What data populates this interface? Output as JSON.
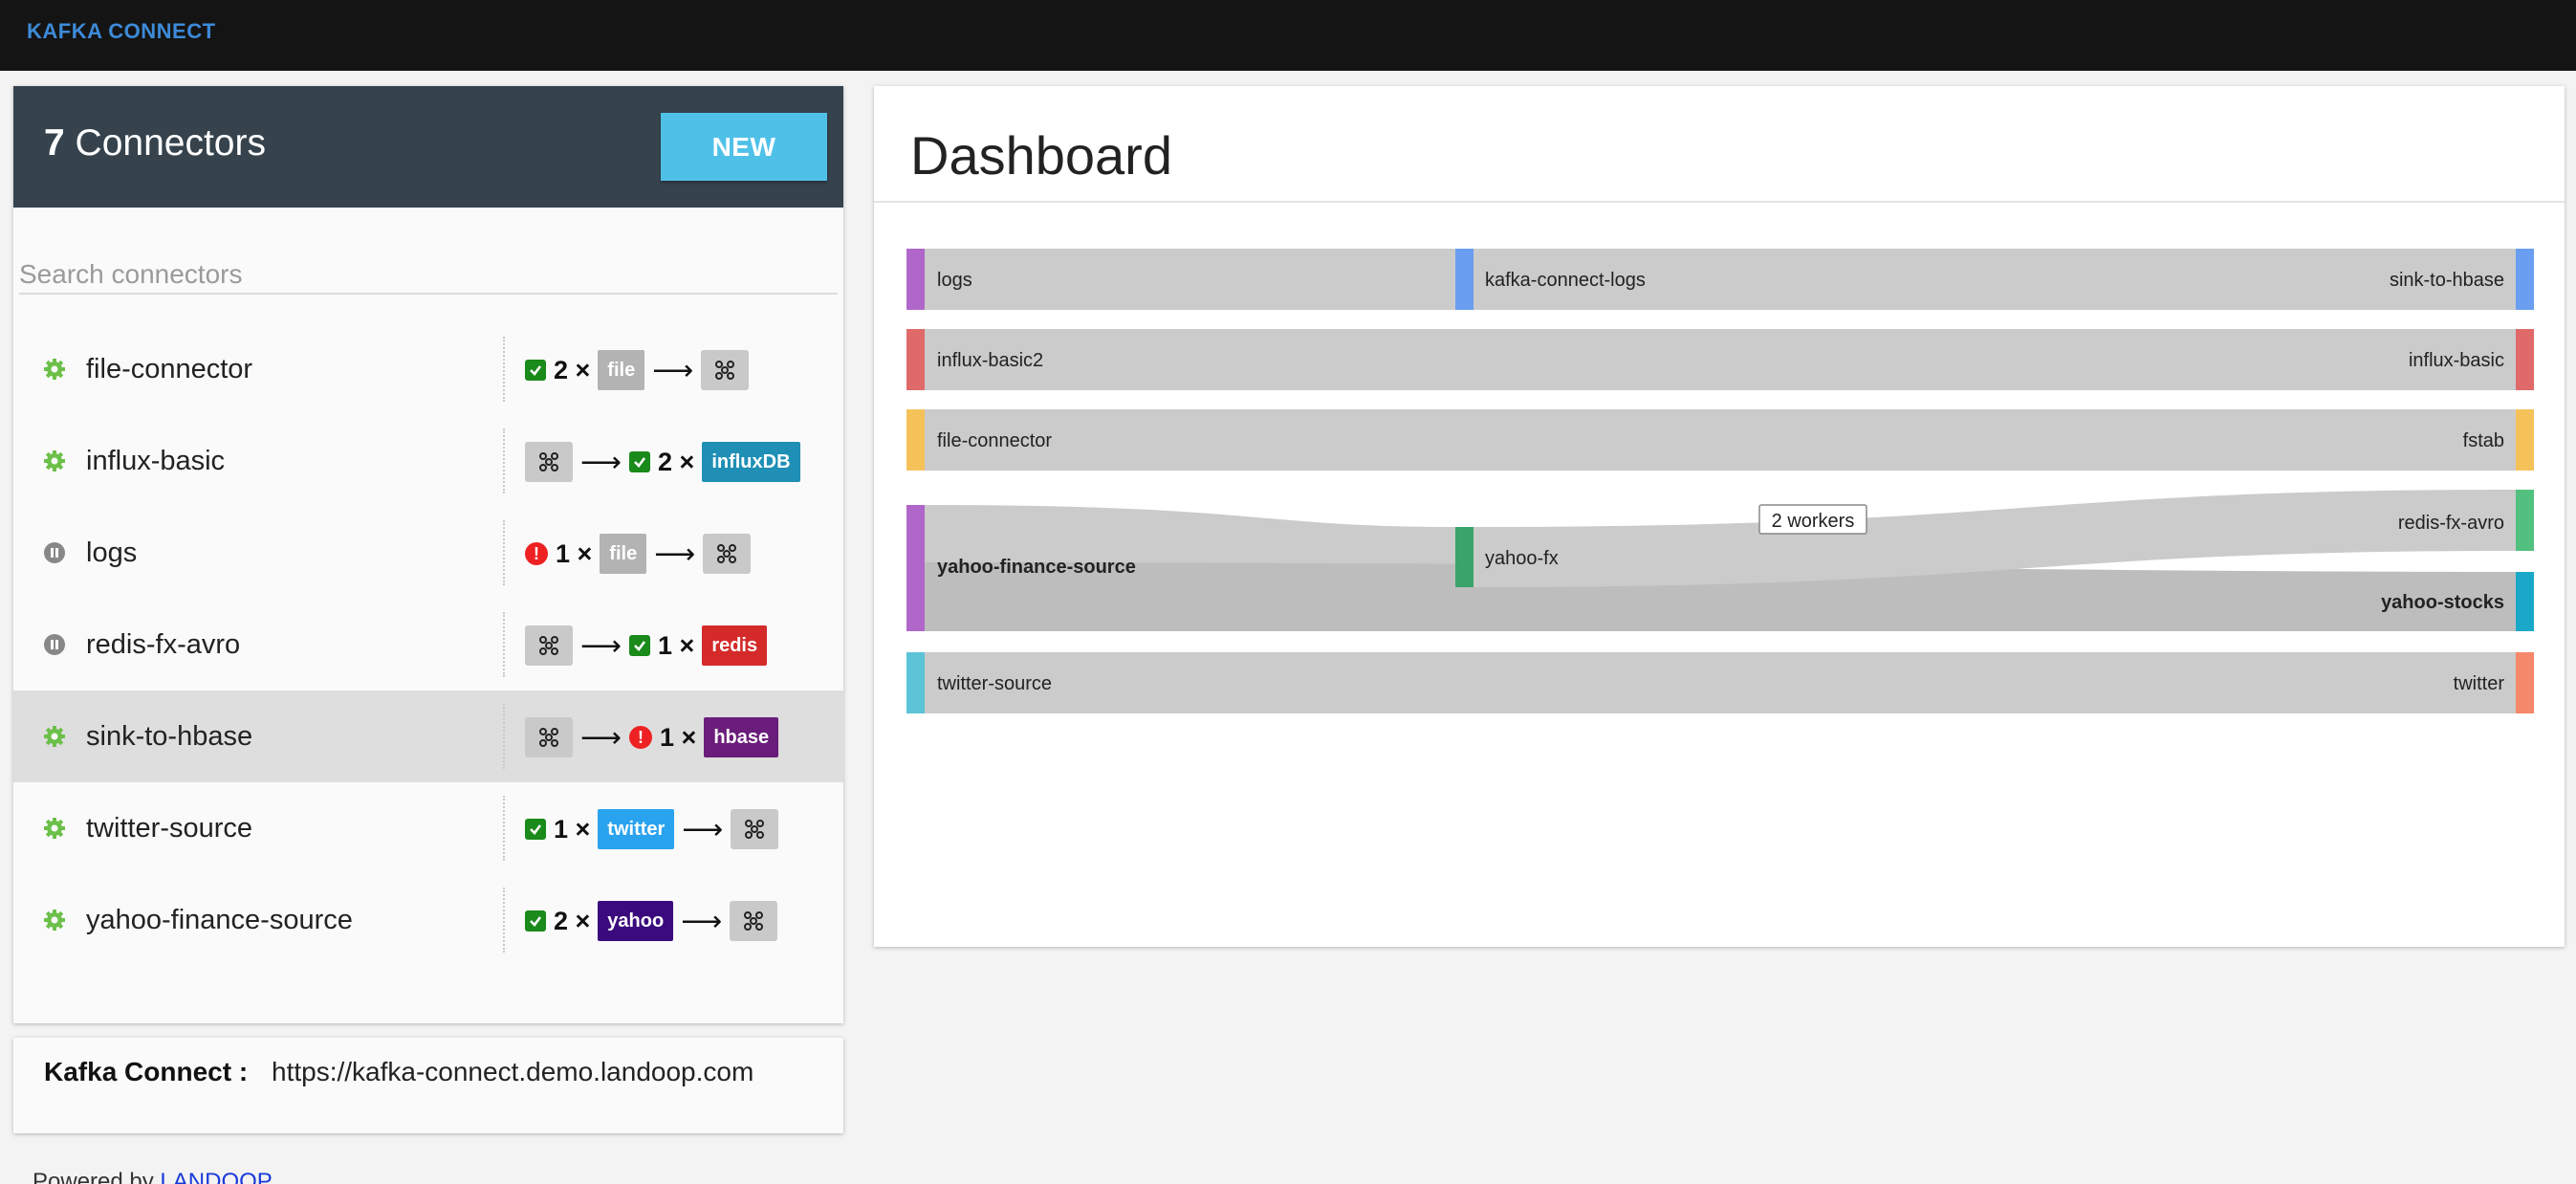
{
  "app": {
    "brand": "KAFKA CONNECT"
  },
  "connectors_panel": {
    "count": "7",
    "title": "Connectors",
    "new_label": "NEW",
    "search_placeholder": "Search connectors",
    "items": [
      {
        "name": "file-connector",
        "status": "running",
        "flow": [
          {
            "k": "check"
          },
          {
            "k": "text",
            "v": "2 ×"
          },
          {
            "k": "tag",
            "v": "file",
            "color": "#b3b3b3"
          },
          {
            "k": "arrow"
          },
          {
            "k": "kafka"
          }
        ]
      },
      {
        "name": "influx-basic",
        "status": "running",
        "flow": [
          {
            "k": "kafka"
          },
          {
            "k": "arrow"
          },
          {
            "k": "check"
          },
          {
            "k": "text",
            "v": "2 ×"
          },
          {
            "k": "tag",
            "v": "influxDB",
            "color": "#1f8fb5"
          }
        ]
      },
      {
        "name": "logs",
        "status": "paused",
        "flow": [
          {
            "k": "error"
          },
          {
            "k": "text",
            "v": "1 ×"
          },
          {
            "k": "tag",
            "v": "file",
            "color": "#b3b3b3"
          },
          {
            "k": "arrow"
          },
          {
            "k": "kafka"
          }
        ]
      },
      {
        "name": "redis-fx-avro",
        "status": "paused",
        "flow": [
          {
            "k": "kafka"
          },
          {
            "k": "arrow"
          },
          {
            "k": "check"
          },
          {
            "k": "text",
            "v": "1 ×"
          },
          {
            "k": "tag",
            "v": "redis",
            "color": "#d42a2a"
          }
        ]
      },
      {
        "name": "sink-to-hbase",
        "status": "running",
        "selected": true,
        "flow": [
          {
            "k": "kafka"
          },
          {
            "k": "arrow"
          },
          {
            "k": "error"
          },
          {
            "k": "text",
            "v": "1 ×"
          },
          {
            "k": "tag",
            "v": "hbase",
            "color": "#6a1d7a"
          }
        ]
      },
      {
        "name": "twitter-source",
        "status": "running",
        "flow": [
          {
            "k": "check"
          },
          {
            "k": "text",
            "v": "1 ×"
          },
          {
            "k": "tag",
            "v": "twitter",
            "color": "#2aa3ef"
          },
          {
            "k": "arrow"
          },
          {
            "k": "kafka"
          }
        ]
      },
      {
        "name": "yahoo-finance-source",
        "status": "running",
        "flow": [
          {
            "k": "check"
          },
          {
            "k": "text",
            "v": "2 ×"
          },
          {
            "k": "tag",
            "v": "yahoo",
            "color": "#3b0a7d"
          },
          {
            "k": "arrow"
          },
          {
            "k": "kafka"
          }
        ]
      }
    ]
  },
  "info": {
    "label": "Kafka Connect :",
    "url": "https://kafka-connect.demo.landoop.com"
  },
  "footer": {
    "powered_by": "Powered by",
    "link": "LANDOOP"
  },
  "dashboard": {
    "title": "Dashboard",
    "tooltip": "2 workers",
    "flows": [
      {
        "source": "logs",
        "topic": "kafka-connect-logs",
        "sink": "sink-to-hbase",
        "source_color": "#b067c9",
        "topic_color": "#6a9ef0",
        "sink_color": "#6a9ef0"
      },
      {
        "source": "influx-basic2",
        "topic": "",
        "sink": "influx-basic",
        "source_color": "#e06a6a",
        "sink_color": "#e06a6a"
      },
      {
        "source": "file-connector",
        "topic": "",
        "sink": "fstab",
        "source_color": "#f5c25a",
        "sink_color": "#f5c25a"
      },
      {
        "source": "yahoo-finance-source",
        "topic": "yahoo-fx",
        "sinks": [
          "redis-fx-avro",
          "yahoo-stocks"
        ],
        "source_color": "#b067c9",
        "topic_color": "#3aa36a",
        "sink_colors": [
          "#52c07e",
          "#1aa8c8"
        ]
      },
      {
        "source": "twitter-source",
        "topic": "",
        "sink": "twitter",
        "source_color": "#5cc4d6",
        "sink_color": "#f5876a"
      }
    ]
  }
}
